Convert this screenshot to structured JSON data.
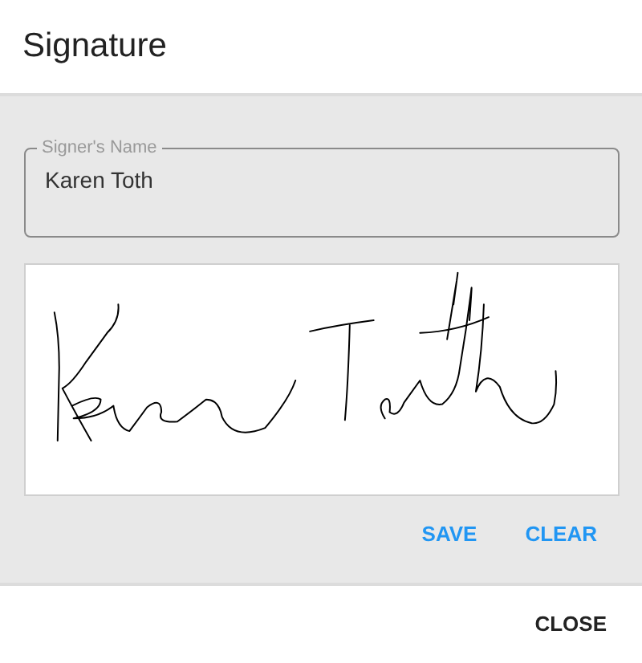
{
  "dialog": {
    "title": "Signature"
  },
  "signer_field": {
    "label": "Signer's Name",
    "value": "Karen Toth"
  },
  "signature_pad": {
    "kind": "picture"
  },
  "pad_buttons": [
    "SAVE",
    "CLEAR"
  ],
  "footer_buttons": [
    "CLOSE"
  ]
}
